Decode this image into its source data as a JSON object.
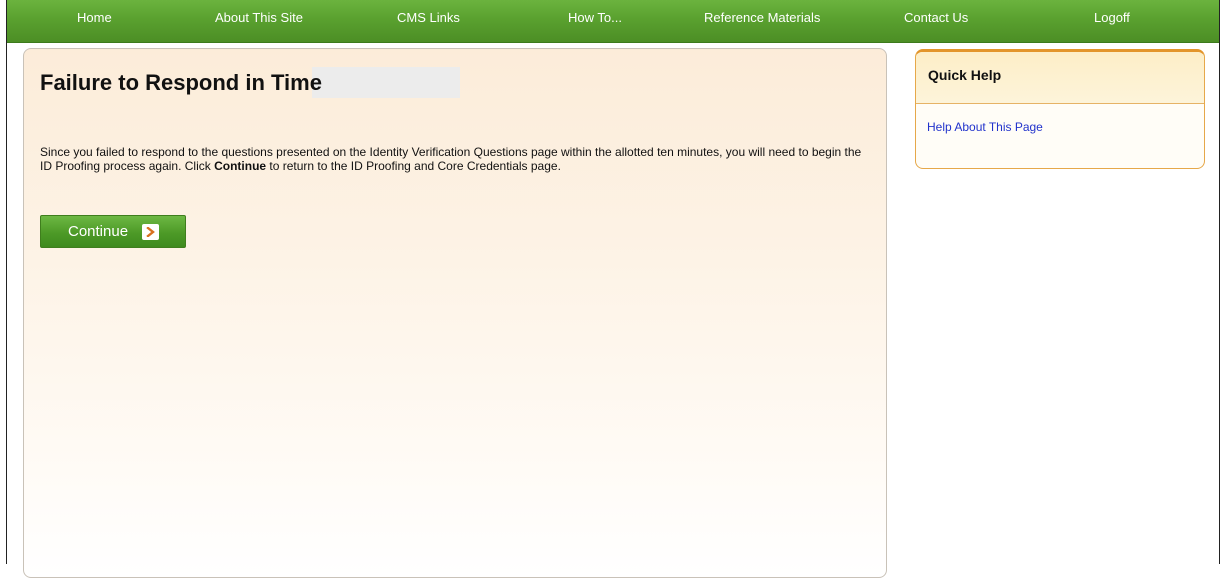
{
  "nav": {
    "items": [
      {
        "label": "Home"
      },
      {
        "label": "About This Site"
      },
      {
        "label": "CMS Links"
      },
      {
        "label": "How To..."
      },
      {
        "label": "Reference Materials"
      },
      {
        "label": "Contact Us"
      },
      {
        "label": "Logoff"
      }
    ]
  },
  "main": {
    "title": "Failure to Respond in Time",
    "message_part1": "Since you failed to respond to the questions presented on the Identity Verification Questions page within the allotted ten minutes, you will need to begin the ID Proofing process again. Click ",
    "message_bold": "Continue",
    "message_part2": " to return to the ID Proofing and Core Credentials page.",
    "continue_label": "Continue"
  },
  "quick_help": {
    "title": "Quick Help",
    "link_label": "Help About This Page"
  },
  "icons": {
    "continue_arrow": "chevron-right-icon"
  },
  "colors": {
    "nav_green": "#5aa12f",
    "button_green": "#4d9a27",
    "quick_help_border": "#e3952b",
    "link_blue": "#2233cc",
    "arrow_orange": "#d9701f"
  }
}
